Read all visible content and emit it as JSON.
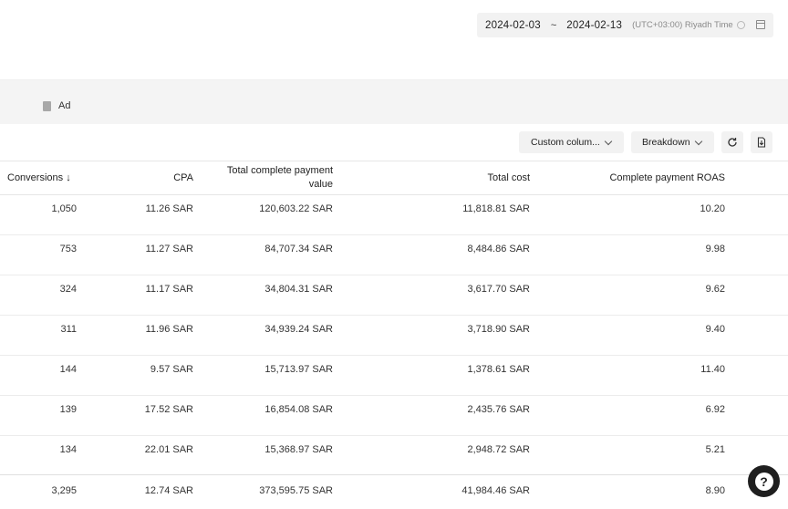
{
  "date_range": {
    "start": "2024-02-03",
    "separator": "~",
    "end": "2024-02-13",
    "timezone": "(UTC+03:00) Riyadh Time"
  },
  "tabs": {
    "ad_label": "Ad"
  },
  "toolbar": {
    "custom_columns_label": "Custom colum...",
    "breakdown_label": "Breakdown"
  },
  "table": {
    "headers": {
      "conversions": "Conversions ↓",
      "cpa": "CPA",
      "total_payment_value_line1": "Total complete payment",
      "total_payment_value_line2": "value",
      "total_cost": "Total cost",
      "roas": "Complete payment ROAS"
    },
    "rows": [
      {
        "conversions": "1,050",
        "cpa": "11.26 SAR",
        "tpv": "120,603.22 SAR",
        "cost": "11,818.81 SAR",
        "roas": "10.20"
      },
      {
        "conversions": "753",
        "cpa": "11.27 SAR",
        "tpv": "84,707.34 SAR",
        "cost": "8,484.86 SAR",
        "roas": "9.98"
      },
      {
        "conversions": "324",
        "cpa": "11.17 SAR",
        "tpv": "34,804.31 SAR",
        "cost": "3,617.70 SAR",
        "roas": "9.62"
      },
      {
        "conversions": "311",
        "cpa": "11.96 SAR",
        "tpv": "34,939.24 SAR",
        "cost": "3,718.90 SAR",
        "roas": "9.40"
      },
      {
        "conversions": "144",
        "cpa": "9.57 SAR",
        "tpv": "15,713.97 SAR",
        "cost": "1,378.61 SAR",
        "roas": "11.40"
      },
      {
        "conversions": "139",
        "cpa": "17.52 SAR",
        "tpv": "16,854.08 SAR",
        "cost": "2,435.76 SAR",
        "roas": "6.92"
      },
      {
        "conversions": "134",
        "cpa": "22.01 SAR",
        "tpv": "15,368.97 SAR",
        "cost": "2,948.72 SAR",
        "roas": "5.21"
      }
    ],
    "total": {
      "conversions": "3,295",
      "cpa": "12.74 SAR",
      "tpv": "373,595.75 SAR",
      "cost": "41,984.46 SAR",
      "roas": "8.90"
    }
  },
  "help": {
    "glyph": "?"
  }
}
